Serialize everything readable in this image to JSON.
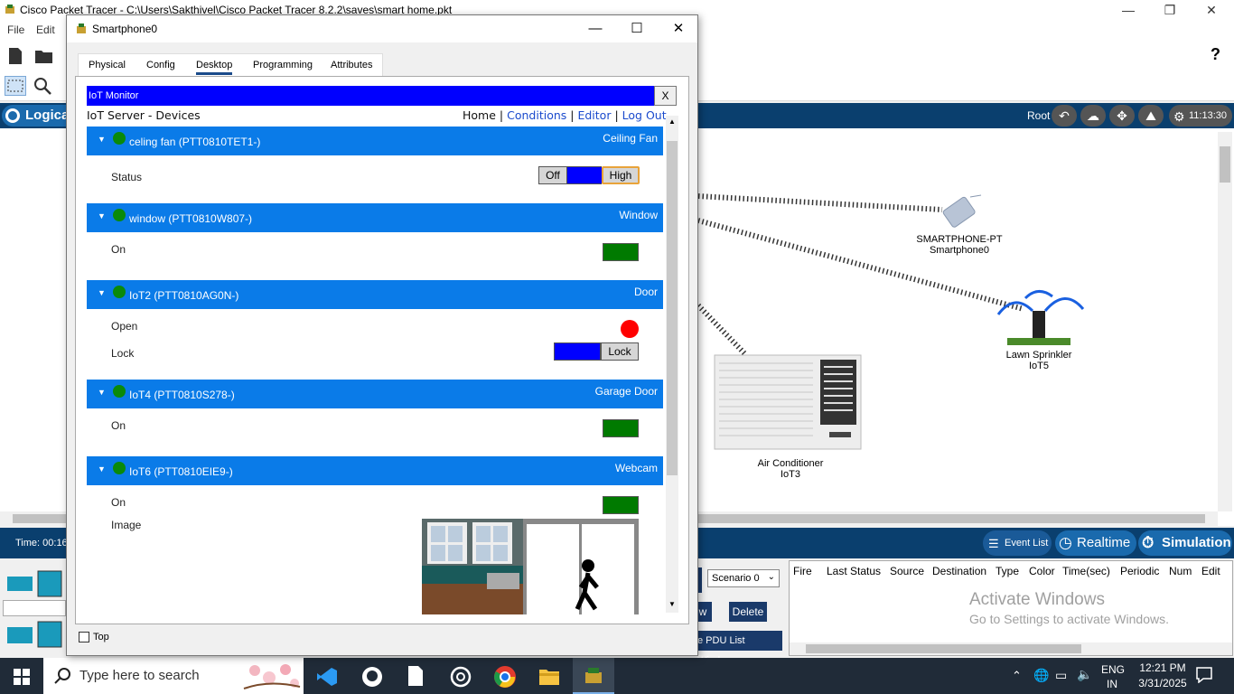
{
  "app": {
    "title": "Cisco Packet Tracer - C:\\Users\\Sakthivel\\Cisco Packet Tracer 8.2.2\\saves\\smart home.pkt",
    "menu": [
      "File",
      "Edit"
    ],
    "help_icon": "?",
    "logical_label": "Logical",
    "root_label": "Root",
    "clock": "11:13:30",
    "time_label": "Time: 00:16"
  },
  "workspace": {
    "devices": [
      {
        "type": "SMARTPHONE-PT",
        "name": "Smartphone0",
        "icon": "smartphone-icon"
      },
      {
        "type": "Lawn Sprinkler",
        "name": "IoT5",
        "icon": "sprinkler-icon"
      },
      {
        "type": "Air Conditioner",
        "name": "IoT3",
        "icon": "air-conditioner-icon"
      }
    ]
  },
  "sim": {
    "event_list": "Event List",
    "realtime": "Realtime",
    "simulation": "Simulation",
    "scenario": "Scenario 0",
    "delete": "Delete",
    "new_partial": "w",
    "pdu_window": "e PDU List Window",
    "columns": [
      "Fire",
      "Last Status",
      "Source",
      "Destination",
      "Type",
      "Color",
      "Time(sec)",
      "Periodic",
      "Num",
      "Edit"
    ],
    "watermark_title": "Activate Windows",
    "watermark_sub": "Go to Settings to activate Windows."
  },
  "dialog": {
    "title": "Smartphone0",
    "tabs": [
      "Physical",
      "Config",
      "Desktop",
      "Programming",
      "Attributes"
    ],
    "active_tab": "Desktop",
    "iot_monitor": "IoT Monitor",
    "close_x": "X",
    "server_title": "IoT Server - Devices",
    "nav": {
      "home": "Home",
      "conditions": "Conditions",
      "editor": "Editor",
      "logout": "Log Out",
      "sep": "|"
    },
    "top_checkbox": "Top",
    "devices": [
      {
        "name": "celing fan (PTT0810TET1-)",
        "type": "Ceiling Fan",
        "props": [
          {
            "label": "Status",
            "off": "Off",
            "high": "High"
          }
        ]
      },
      {
        "name": "window (PTT0810W807-)",
        "type": "Window",
        "props": [
          {
            "label": "On"
          }
        ]
      },
      {
        "name": "IoT2 (PTT0810AG0N-)",
        "type": "Door",
        "props": [
          {
            "label": "Open"
          },
          {
            "label": "Lock",
            "button": "Lock"
          }
        ]
      },
      {
        "name": "IoT4 (PTT0810S278-)",
        "type": "Garage Door",
        "props": [
          {
            "label": "On"
          }
        ]
      },
      {
        "name": "IoT6 (PTT0810EIE9-)",
        "type": "Webcam",
        "props": [
          {
            "label": "On"
          },
          {
            "label": "Image"
          }
        ]
      }
    ],
    "status_color": "#0a8a0a",
    "header_color": "#0a7be8"
  },
  "taskbar": {
    "search_placeholder": "Type here to search",
    "lang": "ENG",
    "region": "IN",
    "time": "12:21 PM",
    "date": "3/31/2025"
  }
}
